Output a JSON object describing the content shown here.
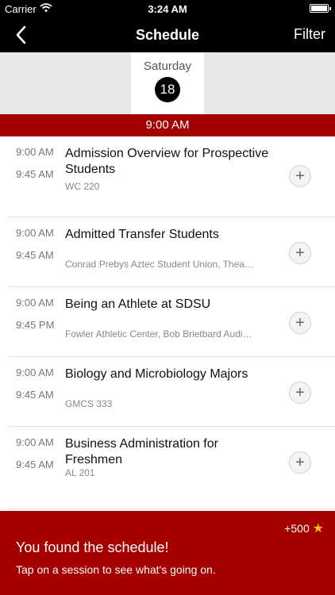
{
  "status_bar": {
    "carrier": "Carrier",
    "time": "3:24 AM"
  },
  "nav": {
    "title": "Schedule",
    "filter_label": "Filter"
  },
  "day": {
    "name": "Saturday",
    "number": "18"
  },
  "time_header": "9:00 AM",
  "sessions": [
    {
      "start": "9:00 AM",
      "end": "9:45 AM",
      "title": "Admission Overview for Prospective Students",
      "location": "WC 220"
    },
    {
      "start": "9:00 AM",
      "end": "9:45 AM",
      "title": "Admitted Transfer Students",
      "location": "Conrad Prebys Aztec Student Union, Thea…"
    },
    {
      "start": "9:00 AM",
      "end": "9:45 PM",
      "title": "Being an Athlete at SDSU",
      "location": "Fowler Athletic Center, Bob Brietbard Audi…"
    },
    {
      "start": "9:00 AM",
      "end": "9:45 AM",
      "title": "Biology and Microbiology Majors",
      "location": "GMCS 333"
    },
    {
      "start": "9:00 AM",
      "end": "9:45 AM",
      "title": "Business Administration for Freshmen",
      "location": "AL 201"
    }
  ],
  "toast": {
    "points": "+500",
    "star_icon": "star-icon",
    "heading": "You found the schedule!",
    "subtitle": "Tap on a session to see what's going on."
  },
  "colors": {
    "accent": "#a50000",
    "bar": "#000000",
    "day_strip": "#e8e8e8"
  }
}
